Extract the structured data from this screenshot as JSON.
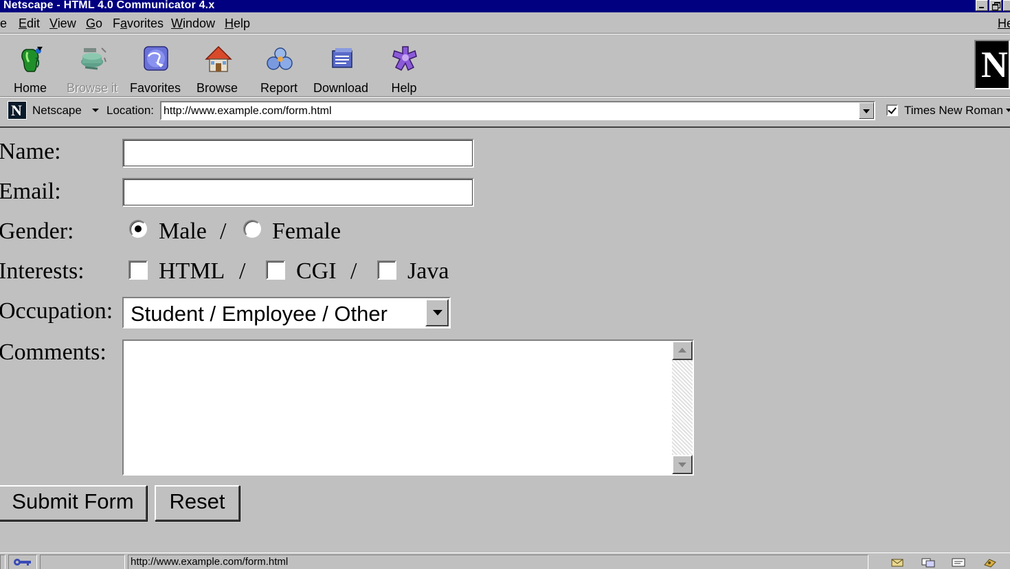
{
  "window": {
    "title": "Netscape - HTML 4.0 Communicator 4.x"
  },
  "menu": {
    "items": [
      {
        "label": "e",
        "mnemonic": ""
      },
      {
        "pre": "",
        "mnemonic": "E",
        "post": "dit"
      },
      {
        "pre": "",
        "mnemonic": "V",
        "post": "iew"
      },
      {
        "pre": "",
        "mnemonic": "G",
        "post": "o"
      },
      {
        "pre": "F",
        "mnemonic": "a",
        "post": "vorites"
      },
      {
        "pre": "",
        "mnemonic": "W",
        "post": "indow"
      },
      {
        "pre": "",
        "mnemonic": "H",
        "post": "elp"
      }
    ],
    "help_right": "He"
  },
  "toolbar": {
    "buttons": [
      {
        "label": "Home",
        "icon": "home-icon"
      },
      {
        "label": "Browse it",
        "icon": "browse-it-icon",
        "disabled": true
      },
      {
        "label": "Favorites",
        "icon": "globe-icon"
      },
      {
        "label": "Browse",
        "icon": "house-icon"
      },
      {
        "label": "Report",
        "icon": "report-icon"
      },
      {
        "label": "Download",
        "icon": "download-icon"
      },
      {
        "label": "Help",
        "icon": "help-icon"
      }
    ],
    "throbber_letter": "N"
  },
  "location": {
    "logo_letter": "N",
    "netscape_label": "Netscape",
    "label": "Location:",
    "url": "http://www.example.com/form.html",
    "font_checked": true,
    "font_name": "Times New Roman"
  },
  "form": {
    "name_label": "Name:",
    "name_value": "",
    "email_label": "Email:",
    "email_value": "",
    "gender_label": "Gender:",
    "gender_options": [
      "Male",
      "Female"
    ],
    "gender_selected": "Male",
    "separator": "/",
    "interests_label": "Interests:",
    "interests_options": [
      "HTML",
      "CGI",
      "Java"
    ],
    "occupation_label": "Occupation:",
    "occupation_value": "Student / Employee / Other",
    "comments_label": "Comments:",
    "comments_value": "",
    "submit_label": "Submit Form",
    "reset_label": "Reset"
  },
  "status": {
    "text": "http://www.example.com/form.html"
  },
  "colors": {
    "titlebar": "#000080",
    "chrome": "#c0c0c0"
  }
}
